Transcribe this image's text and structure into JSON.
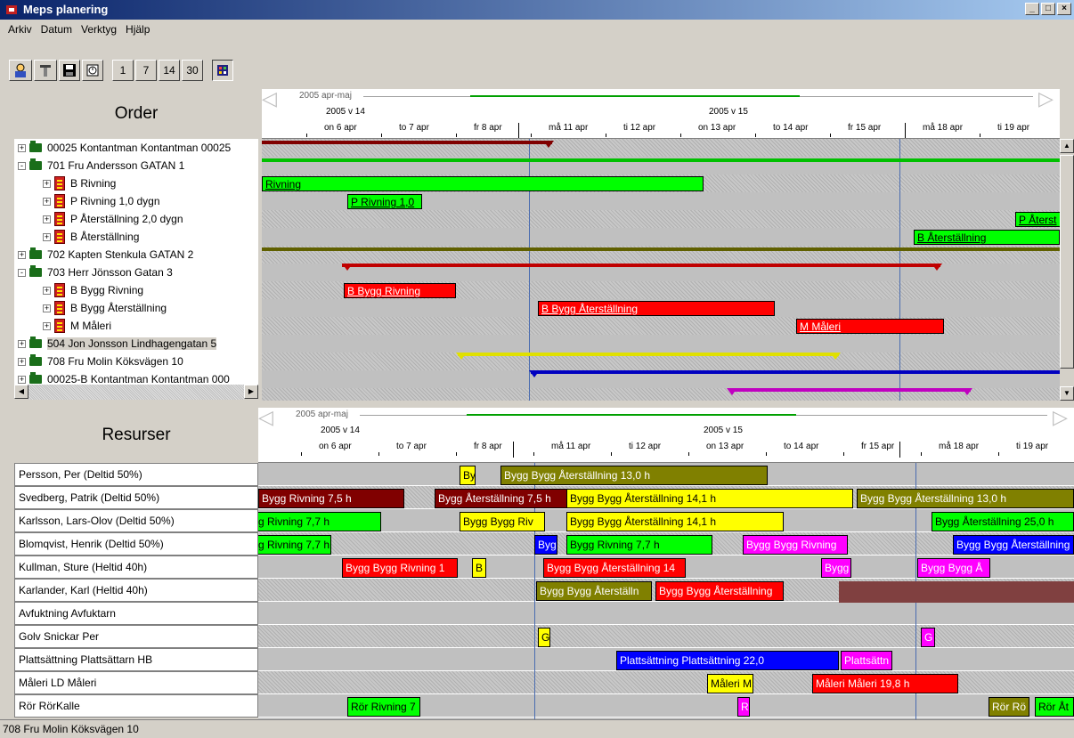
{
  "window": {
    "title": "Meps planering",
    "controls": [
      "_",
      "□",
      "×"
    ]
  },
  "menu": [
    "Arkiv",
    "Datum",
    "Verktyg",
    "Hjälp"
  ],
  "toolbar": {
    "zoom_buttons": [
      "1",
      "7",
      "14",
      "30"
    ]
  },
  "order_panel": {
    "title": "Order",
    "items": [
      {
        "label": "00025 Kontantman Kontantman 00025",
        "level": 0,
        "type": "folder",
        "sign": "+"
      },
      {
        "label": "701 Fru Andersson GATAN 1",
        "level": 0,
        "type": "folder",
        "sign": "−"
      },
      {
        "label": "B Rivning",
        "level": 1,
        "type": "doc",
        "sign": "+"
      },
      {
        "label": "P Rivning 1,0 dygn",
        "level": 1,
        "type": "doc",
        "sign": "+"
      },
      {
        "label": "P Återställning 2,0 dygn",
        "level": 1,
        "type": "doc",
        "sign": "+"
      },
      {
        "label": "B Återställning",
        "level": 1,
        "type": "doc",
        "sign": "+"
      },
      {
        "label": "702 Kapten Stenkula GATAN 2",
        "level": 0,
        "type": "folder",
        "sign": "+"
      },
      {
        "label": "703 Herr Jönsson Gatan 3",
        "level": 0,
        "type": "folder",
        "sign": "−"
      },
      {
        "label": "B Bygg Rivning",
        "level": 1,
        "type": "doc",
        "sign": "+"
      },
      {
        "label": "B Bygg Återställning",
        "level": 1,
        "type": "doc",
        "sign": "+"
      },
      {
        "label": "M Måleri",
        "level": 1,
        "type": "doc",
        "sign": "+"
      },
      {
        "label": "504 Jon Jonsson Lindhagengatan 5",
        "level": 0,
        "type": "folder",
        "sign": "+",
        "selected": true
      },
      {
        "label": "708 Fru Molin Köksvägen 10",
        "level": 0,
        "type": "folder",
        "sign": "+"
      },
      {
        "label": "00025-B Kontantman Kontantman 000",
        "level": 0,
        "type": "folder",
        "sign": "+"
      }
    ]
  },
  "timeline": {
    "period": "2005 apr-maj",
    "weeks": [
      "2005 v 14",
      "2005 v 15"
    ],
    "days": [
      "on 6 apr",
      "to 7 apr",
      "fr 8 apr",
      "må 11 apr",
      "ti 12 apr",
      "on 13 apr",
      "to 14 apr",
      "fr 15 apr",
      "må 18 apr",
      "ti 19 apr"
    ]
  },
  "order_bars": [
    {
      "label": "Rivning",
      "color": "#00ff00"
    },
    {
      "label": "P Rivning 1,0",
      "color": "#00ff00"
    },
    {
      "label": "P Återst",
      "color": "#00ff00"
    },
    {
      "label": "B Återställning",
      "color": "#00ff00"
    },
    {
      "label": "B Bygg Rivning",
      "color": "#ff0000"
    },
    {
      "label": "B Bygg Återställning",
      "color": "#ff0000"
    },
    {
      "label": "M Måleri",
      "color": "#ff0000"
    }
  ],
  "resource_panel": {
    "title": "Resurser",
    "rows": [
      "Persson, Per (Deltid 50%)",
      "Svedberg, Patrik (Deltid 50%)",
      "Karlsson, Lars-Olov (Deltid 50%)",
      "Blomqvist, Henrik (Deltid 50%)",
      "Kullman, Sture (Heltid 40h)",
      "Karlander, Karl (Heltid 40h)",
      "Avfuktning Avfuktarn",
      "Golv Snickar Per",
      "Plattsättning Plattsättarn HB",
      "Måleri LD Måleri",
      "Rör RörKalle"
    ]
  },
  "resource_bars": [
    {
      "row": 0,
      "label": "Byg",
      "color": "#ffff00"
    },
    {
      "row": 0,
      "label": "Bygg Bygg Återställning 13,0 h",
      "color": "#808000"
    },
    {
      "row": 1,
      "label": "Bygg Rivning 7,5 h",
      "color": "#800000"
    },
    {
      "row": 1,
      "label": "Bygg Återställning 7,5 h",
      "color": "#800000"
    },
    {
      "row": 1,
      "label": "Bygg Bygg Återställning 14,1 h",
      "color": "#ffff00"
    },
    {
      "row": 1,
      "label": "Bygg Bygg Återställning 13,0 h",
      "color": "#808000"
    },
    {
      "row": 2,
      "label": "g Rivning 7,7 h",
      "color": "#00ff00"
    },
    {
      "row": 2,
      "label": "Bygg Bygg Riv",
      "color": "#ffff00"
    },
    {
      "row": 2,
      "label": "Bygg Bygg Återställning 14,1 h",
      "color": "#ffff00"
    },
    {
      "row": 2,
      "label": "Bygg Återställning 25,0 h",
      "color": "#00ff00"
    },
    {
      "row": 3,
      "label": "g Rivning 7,7 h",
      "color": "#00ff00"
    },
    {
      "row": 3,
      "label": "Byg",
      "color": "#0000ff"
    },
    {
      "row": 3,
      "label": "Bygg Rivning 7,7 h",
      "color": "#00ff00"
    },
    {
      "row": 3,
      "label": "Bygg Bygg Rivning",
      "color": "#ff00ff"
    },
    {
      "row": 3,
      "label": "Bygg Bygg Återställning",
      "color": "#0000ff"
    },
    {
      "row": 4,
      "label": "Bygg Bygg Rivning 1",
      "color": "#ff0000"
    },
    {
      "row": 4,
      "label": "B",
      "color": "#ffff00"
    },
    {
      "row": 4,
      "label": "Bygg Bygg Återställning 14",
      "color": "#ff0000"
    },
    {
      "row": 4,
      "label": "Bygg B",
      "color": "#ff00ff"
    },
    {
      "row": 4,
      "label": "Bygg Bygg Å",
      "color": "#ff00ff"
    },
    {
      "row": 5,
      "label": "Bygg Bygg Återställn",
      "color": "#808000"
    },
    {
      "row": 5,
      "label": "Bygg Bygg Återställning",
      "color": "#ff0000"
    },
    {
      "row": 7,
      "label": "Golv (",
      "color": "#ffff00"
    },
    {
      "row": 7,
      "label": "G",
      "color": "#ff00ff"
    },
    {
      "row": 8,
      "label": "Plattsättning Plattsättning 22,0",
      "color": "#0000ff"
    },
    {
      "row": 8,
      "label": "Plattsättn",
      "color": "#ff00ff"
    },
    {
      "row": 9,
      "label": "Måleri M",
      "color": "#ffff00"
    },
    {
      "row": 9,
      "label": "Måleri Måleri 19,8 h",
      "color": "#ff0000"
    },
    {
      "row": 10,
      "label": "Rör Rivning 7",
      "color": "#00ff00"
    },
    {
      "row": 10,
      "label": "Rör",
      "color": "#ff00ff"
    },
    {
      "row": 10,
      "label": "Rör Rö",
      "color": "#808000"
    },
    {
      "row": 10,
      "label": "Rör Åt",
      "color": "#00ff00"
    }
  ],
  "status": "708  Fru Molin Köksvägen 10"
}
